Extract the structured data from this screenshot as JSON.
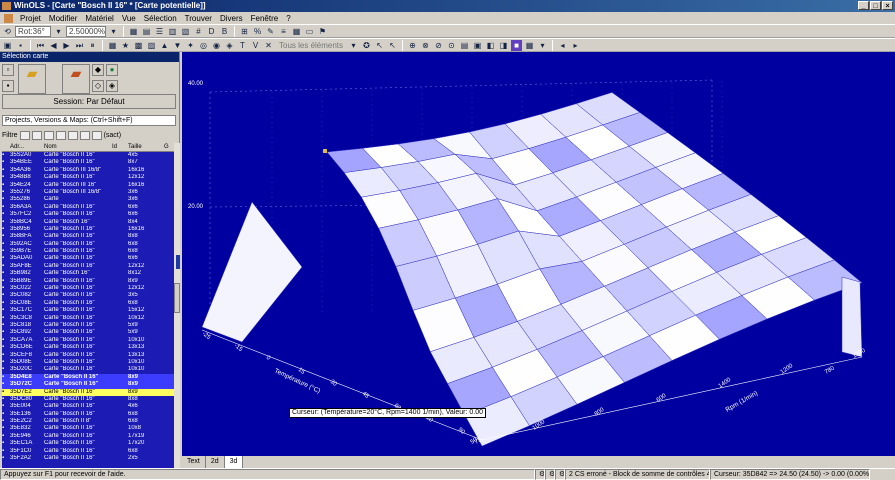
{
  "window": {
    "title": "WinOLS - [Carte \"Bosch II 16\" *  [Carte potentielle]]"
  },
  "menu": [
    "Projet",
    "Modifier",
    "Matériel",
    "Vue",
    "Sélection",
    "Trouver",
    "Divers",
    "Fenêtre",
    "?"
  ],
  "toolbar": {
    "field_a": "Rot:36°",
    "field_b": "2.50000%",
    "filter_text": "Tous les éléments"
  },
  "left_panel": {
    "title": "Sélection carte",
    "session_label": "Session: Par Défaut",
    "project_selector": "Projects, Versions & Maps:  (Ctrl+Shift+F)",
    "filter_label": "Filtre",
    "filter_btn": "(sact)",
    "columns": [
      "Adr...",
      "Nom",
      "Id",
      "Taille",
      "G"
    ],
    "rows": [
      [
        "35S2A0",
        "Carte \"Bosch II 16\"",
        "",
        "4x5"
      ],
      [
        "354BEE",
        "Carte \"Bosch II 16\"",
        "",
        "8x7"
      ],
      [
        "354A36",
        "Carte \"Bosch III 16/8\"",
        "",
        "16x16"
      ],
      [
        "3548B8",
        "Carte \"Bosch II 16\"",
        "",
        "12x12"
      ],
      [
        "354E24",
        "Carte \"Bosch III 16\"",
        "",
        "16x16"
      ],
      [
        "355276",
        "Carte \"Bosch III 16/8\"",
        "",
        "3x6"
      ],
      [
        "355286",
        "Carte",
        "",
        "3x6"
      ],
      [
        "356A3A",
        "Carte \"Bosch II 16\"",
        "",
        "6x6"
      ],
      [
        "357FC2",
        "Carte \"Bosch II 16\"",
        "",
        "6x6"
      ],
      [
        "358BC4",
        "Carte \"Bosch 16\"",
        "",
        "8x4"
      ],
      [
        "358956",
        "Carte \"Bosch II 16\"",
        "",
        "16x16"
      ],
      [
        "358BFA",
        "Carte \"Bosch II 16\"",
        "",
        "8x8"
      ],
      [
        "3592AC",
        "Carte \"Bosch II 16\"",
        "",
        "6x8"
      ],
      [
        "359B7E",
        "Carte \"Bosch II 16\"",
        "",
        "6x8"
      ],
      [
        "35ADA0",
        "Carte \"Bosch II 16\"",
        "",
        "6x6"
      ],
      [
        "35AF8E",
        "Carte \"Bosch II 16\"",
        "",
        "12x12"
      ],
      [
        "35B982",
        "Carte \"Bosch 16\"",
        "",
        "8x12"
      ],
      [
        "35B89E",
        "Carte \"Bosch II 16\"",
        "",
        "8x9"
      ],
      [
        "35C022",
        "Carte \"Bosch II 16\"",
        "",
        "12x12"
      ],
      [
        "35C082",
        "Carte \"Bosch II 16\"",
        "",
        "3x5"
      ],
      [
        "35C08E",
        "Carte \"Bosch II 16\"",
        "",
        "6x8"
      ],
      [
        "35C17C",
        "Carte \"Bosch II 16\"",
        "",
        "15x12"
      ],
      [
        "35C3C8",
        "Carte \"Bosch II 16\"",
        "",
        "10x12"
      ],
      [
        "35C818",
        "Carte \"Bosch II 16\"",
        "",
        "5x9"
      ],
      [
        "35C892",
        "Carte \"Bosch II 16\"",
        "",
        "5x9"
      ],
      [
        "35CA7A",
        "Carte \"Bosch II 16\"",
        "",
        "10x10"
      ],
      [
        "35CD6E",
        "Carte \"Bosch II 16\"",
        "",
        "13x13"
      ],
      [
        "35CEF8",
        "Carte \"Bosch II 16\"",
        "",
        "13x13"
      ],
      [
        "35D08E",
        "Carte \"Bosch II 16\"",
        "",
        "10x10"
      ],
      [
        "35D20C",
        "Carte \"Bosch II 16\"",
        "",
        "10x10"
      ],
      [
        "35D4E8",
        "Carte \"Bosch II 16\"",
        "",
        "8x9",
        "hl"
      ],
      [
        "35D72C",
        "Carte \"Bosch II 16\"",
        "",
        "8x9",
        "hl"
      ],
      [
        "35D7E2",
        "Carte \"Bosch II 16\"",
        "",
        "8x9",
        "sel"
      ],
      [
        "35DC80",
        "Carte \"Bosch II 16\"",
        "",
        "8x8"
      ],
      [
        "35E004",
        "Carte \"Bosch II 16\"",
        "",
        "4x6"
      ],
      [
        "35E136",
        "Carte \"Bosch II 16\"",
        "",
        "6x8"
      ],
      [
        "35E2C2",
        "Carte \"Bosch II 8\"",
        "",
        "6x8"
      ],
      [
        "35E832",
        "Carte \"Bosch II 16\"",
        "",
        "10x8"
      ],
      [
        "35E946",
        "Carte \"Bosch II 16\"",
        "",
        "17x19"
      ],
      [
        "35EC1A",
        "Carte \"Bosch II 16\"",
        "",
        "17x20"
      ],
      [
        "35F1C0",
        "Carte \"Bosch II 16\"",
        "",
        "6x8"
      ],
      [
        "35F2A2",
        "Carte \"Bosch II 16\"",
        "",
        "2x5"
      ]
    ]
  },
  "view": {
    "z_ticks": [
      "40.00",
      "20.00"
    ],
    "axis_temp_label": "Température (°C)",
    "axis_rpm_label": "Rpm (1/min)",
    "temp_ticks": [
      "-25",
      "-15",
      "0",
      "15",
      "30",
      "45",
      "60",
      "80",
      "90"
    ],
    "rpm_ticks": [
      "50",
      "1000",
      "800",
      "600",
      "1400",
      "1200"
    ],
    "right_ticks": [
      "780",
      "1380",
      "75"
    ],
    "cursor_text": "Curseur: (Température=20°C, Rpm=1400 1/min), Valeur: 0.00",
    "tabs": [
      "Text",
      "2d",
      "3d"
    ]
  },
  "status": {
    "help": "Appuyez sur F1 pour recevoir de l'aide.",
    "checksum": "2 CS erroné - Block de somme de contrôles 43 : ok",
    "cursor": "Curseur: 35D842 => 24.50 (24.50) -> 0.00 (0.00%), Largeur: 8"
  }
}
